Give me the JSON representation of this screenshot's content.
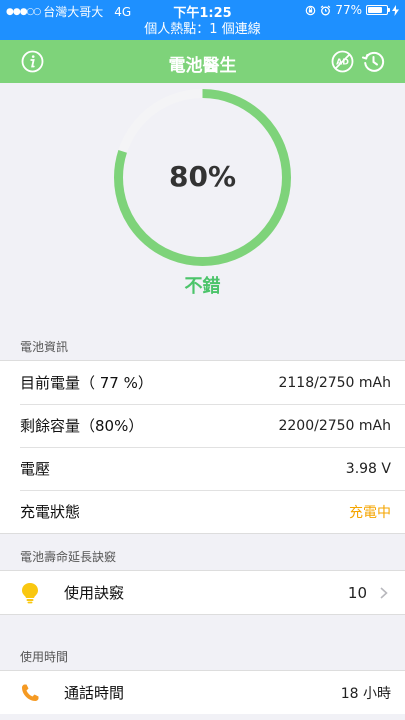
{
  "status_bar": {
    "carrier": "台灣大哥大",
    "network": "4G",
    "time": "下午1:25",
    "battery_percent": "77%",
    "battery_level": 0.77
  },
  "hotspot_banner": "個人熱點：1 個連線",
  "navbar": {
    "title": "電池醫生",
    "icons": [
      "info-icon",
      "no-ads-icon",
      "history-icon"
    ]
  },
  "gauge": {
    "percent_label": "80%",
    "value": 0.8,
    "status": "不錯",
    "colors": {
      "fill": "#7ed37a",
      "track": "#f4f4f6"
    }
  },
  "battery_info": {
    "header": "電池資訊",
    "rows": [
      {
        "label": "目前電量（ 77 %）",
        "value": "2118/2750 mAh"
      },
      {
        "label": "剩餘容量（80%）",
        "value": "2200/2750 mAh"
      },
      {
        "label": "電壓",
        "value": "3.98 V"
      },
      {
        "label": "充電狀態",
        "value": "充電中"
      }
    ]
  },
  "tips": {
    "header": "電池壽命延長訣竅",
    "label": "使用訣竅",
    "count": "10",
    "icon": "lightbulb-icon"
  },
  "usage": {
    "header": "使用時間",
    "label": "通話時間",
    "value": "18 小時",
    "icon": "phone-icon"
  },
  "colors": {
    "status_bar": "#1e90ff",
    "navbar": "#7ed37a",
    "status_text": "#4cc46a",
    "charging": "#f5a500",
    "icon_yellow": "#f9c710",
    "icon_orange": "#f59a23"
  }
}
